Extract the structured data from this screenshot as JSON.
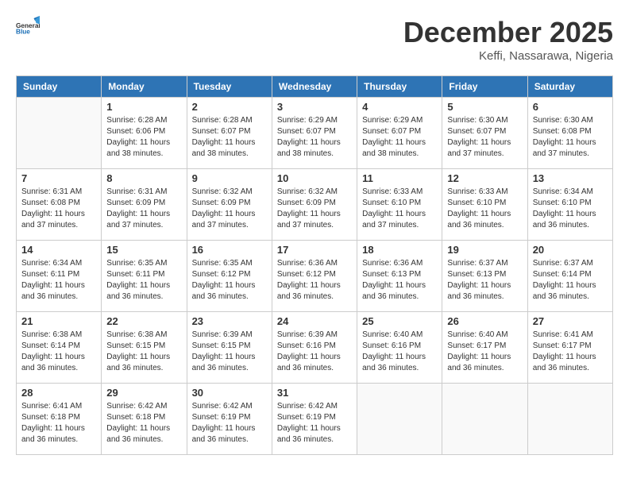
{
  "header": {
    "logo_general": "General",
    "logo_blue": "Blue",
    "month_title": "December 2025",
    "location": "Keffi, Nassarawa, Nigeria"
  },
  "days_of_week": [
    "Sunday",
    "Monday",
    "Tuesday",
    "Wednesday",
    "Thursday",
    "Friday",
    "Saturday"
  ],
  "weeks": [
    [
      {
        "day": "",
        "info": ""
      },
      {
        "day": "1",
        "info": "Sunrise: 6:28 AM\nSunset: 6:06 PM\nDaylight: 11 hours\nand 38 minutes."
      },
      {
        "day": "2",
        "info": "Sunrise: 6:28 AM\nSunset: 6:07 PM\nDaylight: 11 hours\nand 38 minutes."
      },
      {
        "day": "3",
        "info": "Sunrise: 6:29 AM\nSunset: 6:07 PM\nDaylight: 11 hours\nand 38 minutes."
      },
      {
        "day": "4",
        "info": "Sunrise: 6:29 AM\nSunset: 6:07 PM\nDaylight: 11 hours\nand 38 minutes."
      },
      {
        "day": "5",
        "info": "Sunrise: 6:30 AM\nSunset: 6:07 PM\nDaylight: 11 hours\nand 37 minutes."
      },
      {
        "day": "6",
        "info": "Sunrise: 6:30 AM\nSunset: 6:08 PM\nDaylight: 11 hours\nand 37 minutes."
      }
    ],
    [
      {
        "day": "7",
        "info": "Sunrise: 6:31 AM\nSunset: 6:08 PM\nDaylight: 11 hours\nand 37 minutes."
      },
      {
        "day": "8",
        "info": "Sunrise: 6:31 AM\nSunset: 6:09 PM\nDaylight: 11 hours\nand 37 minutes."
      },
      {
        "day": "9",
        "info": "Sunrise: 6:32 AM\nSunset: 6:09 PM\nDaylight: 11 hours\nand 37 minutes."
      },
      {
        "day": "10",
        "info": "Sunrise: 6:32 AM\nSunset: 6:09 PM\nDaylight: 11 hours\nand 37 minutes."
      },
      {
        "day": "11",
        "info": "Sunrise: 6:33 AM\nSunset: 6:10 PM\nDaylight: 11 hours\nand 37 minutes."
      },
      {
        "day": "12",
        "info": "Sunrise: 6:33 AM\nSunset: 6:10 PM\nDaylight: 11 hours\nand 36 minutes."
      },
      {
        "day": "13",
        "info": "Sunrise: 6:34 AM\nSunset: 6:10 PM\nDaylight: 11 hours\nand 36 minutes."
      }
    ],
    [
      {
        "day": "14",
        "info": "Sunrise: 6:34 AM\nSunset: 6:11 PM\nDaylight: 11 hours\nand 36 minutes."
      },
      {
        "day": "15",
        "info": "Sunrise: 6:35 AM\nSunset: 6:11 PM\nDaylight: 11 hours\nand 36 minutes."
      },
      {
        "day": "16",
        "info": "Sunrise: 6:35 AM\nSunset: 6:12 PM\nDaylight: 11 hours\nand 36 minutes."
      },
      {
        "day": "17",
        "info": "Sunrise: 6:36 AM\nSunset: 6:12 PM\nDaylight: 11 hours\nand 36 minutes."
      },
      {
        "day": "18",
        "info": "Sunrise: 6:36 AM\nSunset: 6:13 PM\nDaylight: 11 hours\nand 36 minutes."
      },
      {
        "day": "19",
        "info": "Sunrise: 6:37 AM\nSunset: 6:13 PM\nDaylight: 11 hours\nand 36 minutes."
      },
      {
        "day": "20",
        "info": "Sunrise: 6:37 AM\nSunset: 6:14 PM\nDaylight: 11 hours\nand 36 minutes."
      }
    ],
    [
      {
        "day": "21",
        "info": "Sunrise: 6:38 AM\nSunset: 6:14 PM\nDaylight: 11 hours\nand 36 minutes."
      },
      {
        "day": "22",
        "info": "Sunrise: 6:38 AM\nSunset: 6:15 PM\nDaylight: 11 hours\nand 36 minutes."
      },
      {
        "day": "23",
        "info": "Sunrise: 6:39 AM\nSunset: 6:15 PM\nDaylight: 11 hours\nand 36 minutes."
      },
      {
        "day": "24",
        "info": "Sunrise: 6:39 AM\nSunset: 6:16 PM\nDaylight: 11 hours\nand 36 minutes."
      },
      {
        "day": "25",
        "info": "Sunrise: 6:40 AM\nSunset: 6:16 PM\nDaylight: 11 hours\nand 36 minutes."
      },
      {
        "day": "26",
        "info": "Sunrise: 6:40 AM\nSunset: 6:17 PM\nDaylight: 11 hours\nand 36 minutes."
      },
      {
        "day": "27",
        "info": "Sunrise: 6:41 AM\nSunset: 6:17 PM\nDaylight: 11 hours\nand 36 minutes."
      }
    ],
    [
      {
        "day": "28",
        "info": "Sunrise: 6:41 AM\nSunset: 6:18 PM\nDaylight: 11 hours\nand 36 minutes."
      },
      {
        "day": "29",
        "info": "Sunrise: 6:42 AM\nSunset: 6:18 PM\nDaylight: 11 hours\nand 36 minutes."
      },
      {
        "day": "30",
        "info": "Sunrise: 6:42 AM\nSunset: 6:19 PM\nDaylight: 11 hours\nand 36 minutes."
      },
      {
        "day": "31",
        "info": "Sunrise: 6:42 AM\nSunset: 6:19 PM\nDaylight: 11 hours\nand 36 minutes."
      },
      {
        "day": "",
        "info": ""
      },
      {
        "day": "",
        "info": ""
      },
      {
        "day": "",
        "info": ""
      }
    ]
  ]
}
